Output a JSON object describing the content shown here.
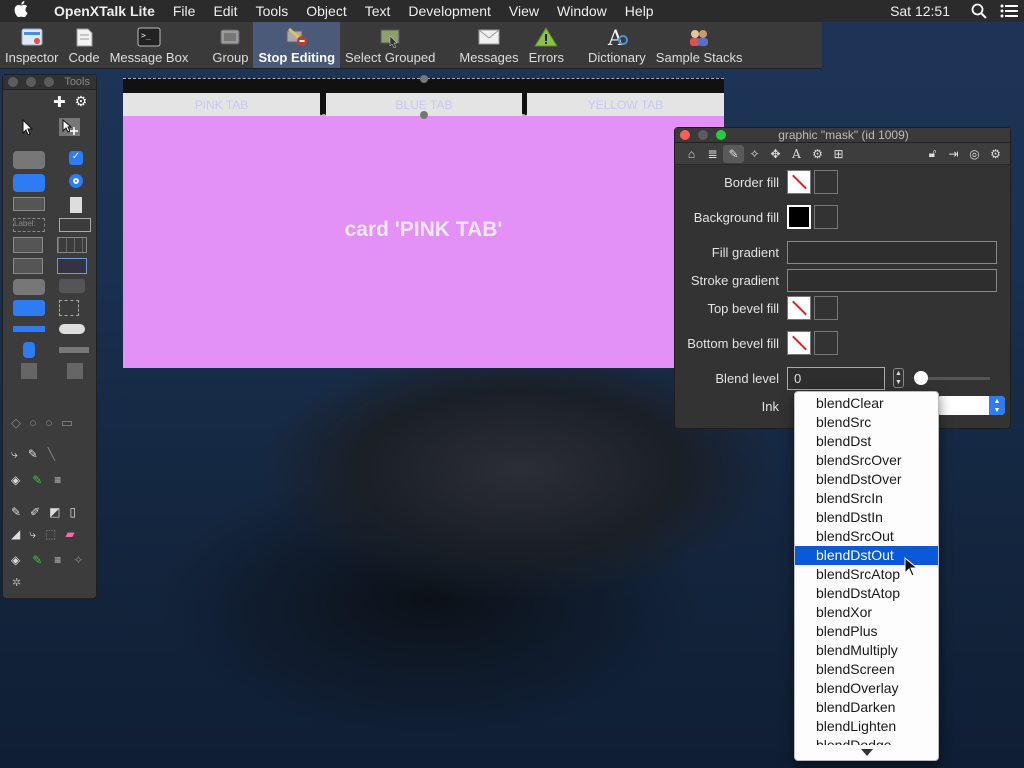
{
  "menubar": {
    "app_name": "OpenXTalk Lite",
    "items": [
      "File",
      "Edit",
      "Tools",
      "Object",
      "Text",
      "Development",
      "View",
      "Window",
      "Help"
    ],
    "clock": "Sat 12:51"
  },
  "toolbar": {
    "buttons": [
      {
        "label": "Inspector",
        "icon": "inspector-icon",
        "color": "#4a90d9"
      },
      {
        "label": "Code",
        "icon": "code-icon",
        "color": "#e8e8e8"
      },
      {
        "label": "Message Box",
        "icon": "message-box-icon",
        "color": "#222222"
      },
      {
        "label": "Group",
        "icon": "group-icon",
        "color": "#888888"
      },
      {
        "label": "Stop Editing",
        "icon": "stop-editing-icon",
        "color": "#c0392b"
      },
      {
        "label": "Select Grouped",
        "icon": "select-grouped-icon",
        "color": "#6d8e3a"
      },
      {
        "label": "Messages",
        "icon": "messages-icon",
        "color": "#e8e8e8"
      },
      {
        "label": "Errors",
        "icon": "errors-icon",
        "color": "#8bc34a"
      },
      {
        "label": "Dictionary",
        "icon": "dictionary-icon",
        "color": "#f2f2f2"
      },
      {
        "label": "Sample Stacks",
        "icon": "sample-stacks-icon",
        "color": "#d9534f"
      }
    ]
  },
  "tools_palette": {
    "title": "Tools"
  },
  "stack": {
    "tabs": [
      "PINK TAB",
      "BLUE TAB",
      "YELLOW TAB"
    ],
    "card_label": "card 'PINK TAB'",
    "bg_color": "#e391f7"
  },
  "inspector": {
    "title": "graphic \"mask\" (id 1009)",
    "props": {
      "border_fill": "Border fill",
      "background_fill": "Background fill",
      "fill_gradient": "Fill gradient",
      "stroke_gradient": "Stroke gradient",
      "top_bevel_fill": "Top bevel fill",
      "bottom_bevel_fill": "Bottom bevel fill",
      "blend_level": "Blend level",
      "blend_level_value": "0",
      "ink": "Ink"
    }
  },
  "ink_menu": {
    "items": [
      "blendClear",
      "blendSrc",
      "blendDst",
      "blendSrcOver",
      "blendDstOver",
      "blendSrcIn",
      "blendDstIn",
      "blendSrcOut",
      "blendDstOut",
      "blendSrcAtop",
      "blendDstAtop",
      "blendXor",
      "blendPlus",
      "blendMultiply",
      "blendScreen",
      "blendOverlay",
      "blendDarken",
      "blendLighten",
      "blendDodge"
    ],
    "selected": "blendDstOut",
    "selection_color": "#0a5ad8"
  }
}
